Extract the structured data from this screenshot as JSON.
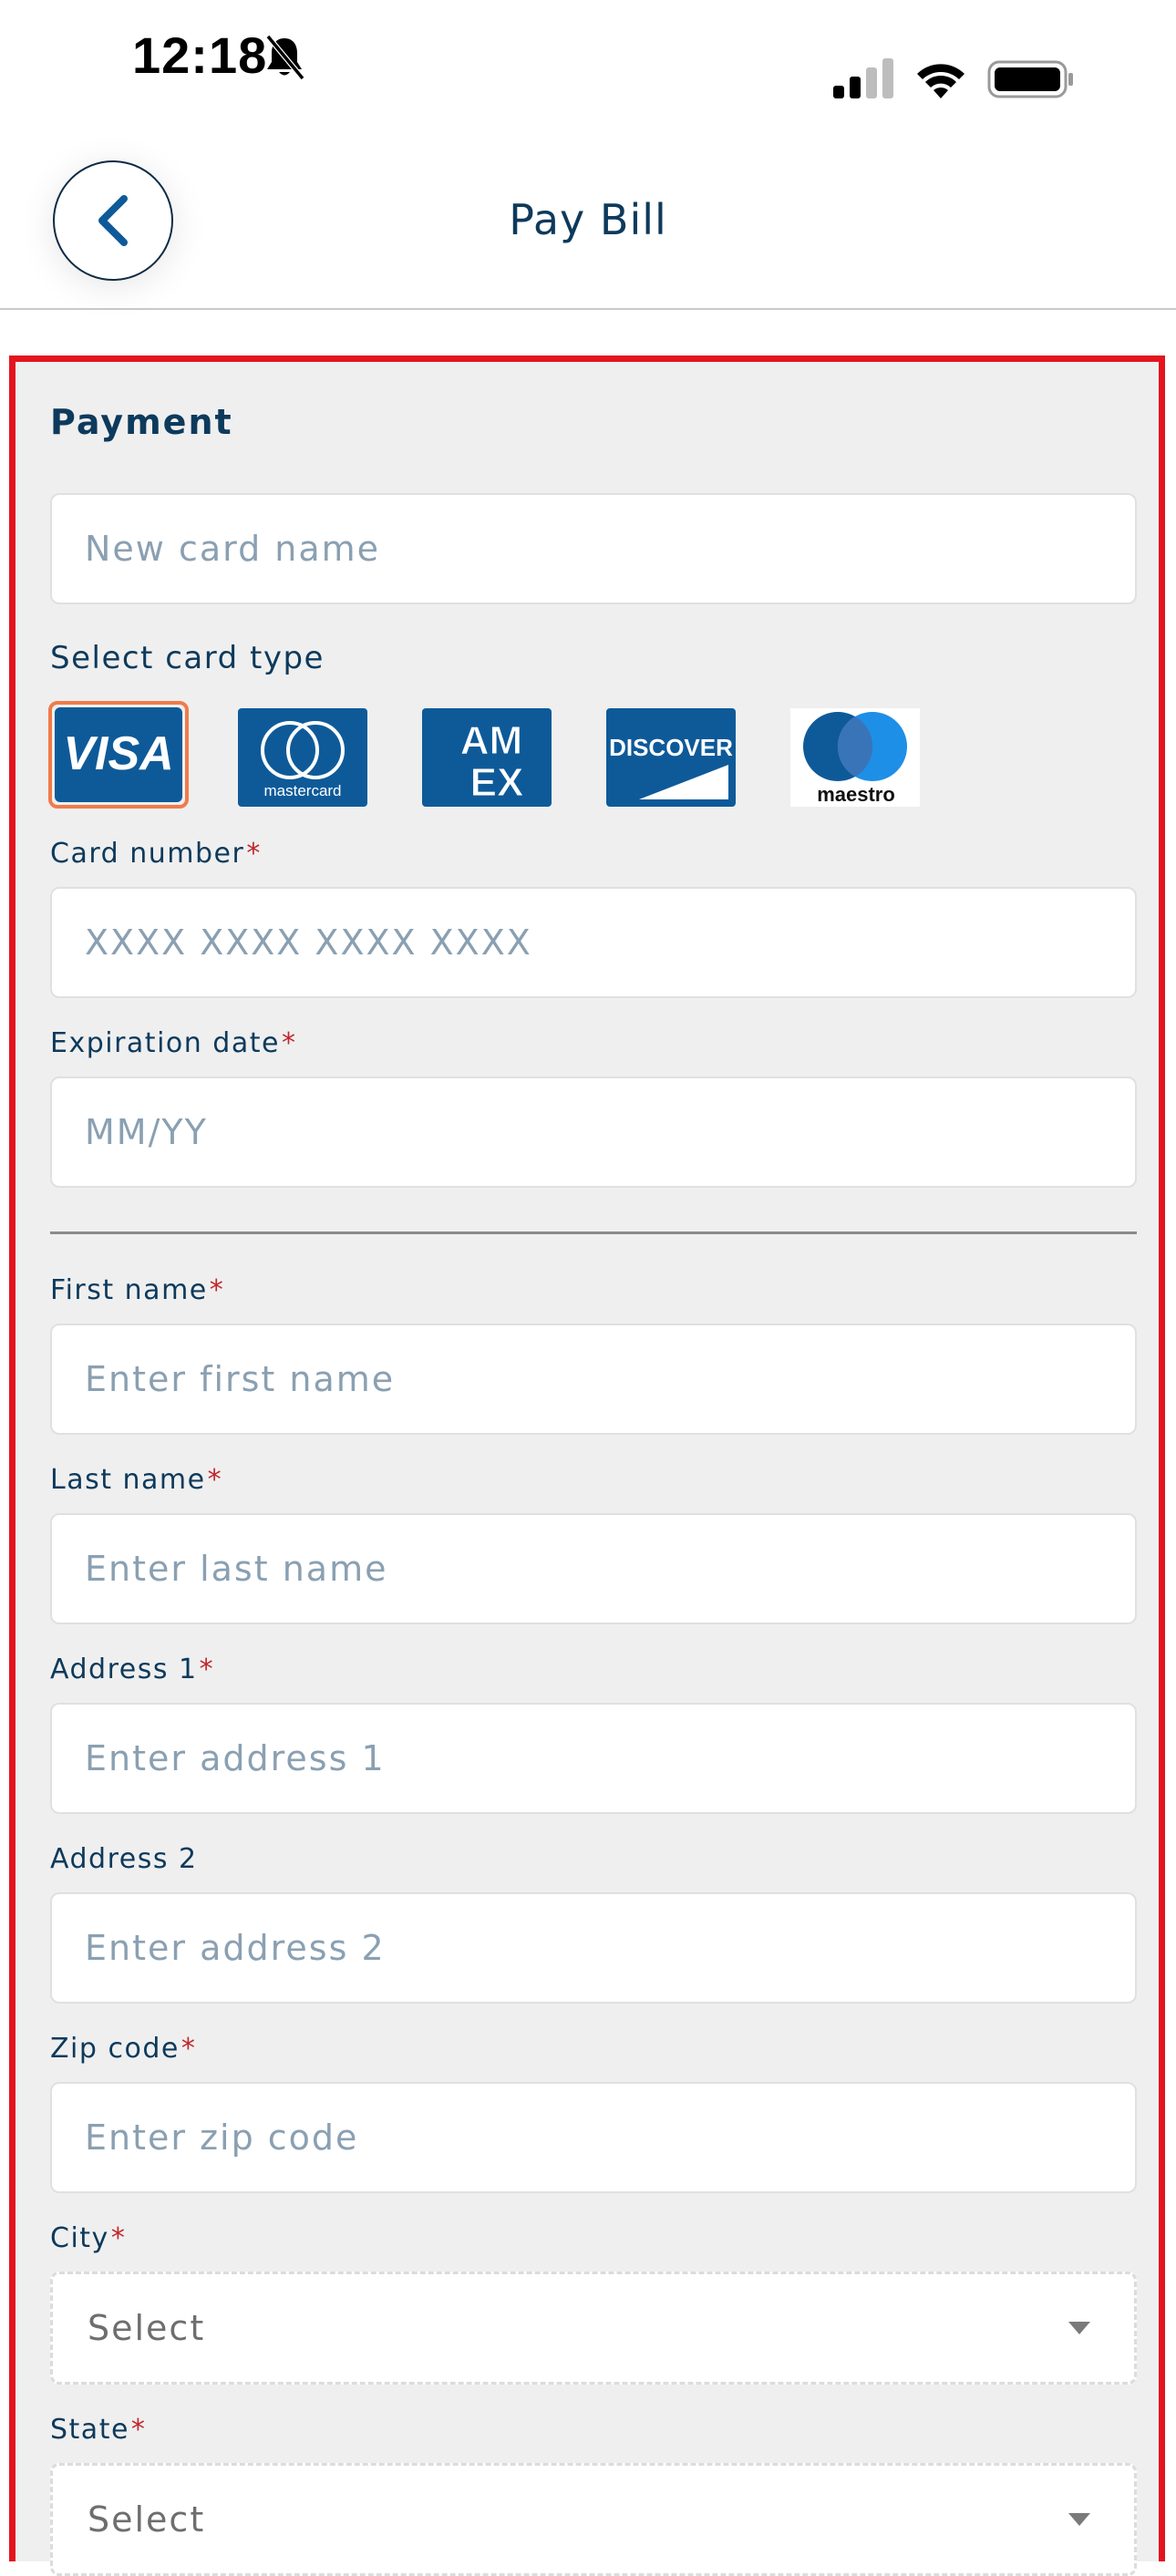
{
  "status_bar": {
    "time": "12:18"
  },
  "header": {
    "title": "Pay Bill"
  },
  "payment": {
    "section_title": "Payment",
    "card_name_placeholder": "New card name",
    "card_type_label": "Select card type",
    "card_types": [
      {
        "name": "VISA",
        "selected": true
      },
      {
        "name": "mastercard",
        "selected": false
      },
      {
        "name": "AM EX",
        "selected": false
      },
      {
        "name": "DISCOVER",
        "selected": false
      },
      {
        "name": "maestro",
        "selected": false
      }
    ],
    "card_number": {
      "label": "Card number",
      "required": "*",
      "placeholder": "XXXX XXXX XXXX XXXX"
    },
    "expiration": {
      "label": "Expiration date",
      "required": "*",
      "placeholder": "MM/YY"
    }
  },
  "billing": {
    "first_name": {
      "label": "First name",
      "required": "*",
      "placeholder": "Enter first name"
    },
    "last_name": {
      "label": "Last name",
      "required": "*",
      "placeholder": "Enter last name"
    },
    "address1": {
      "label": "Address 1",
      "required": "*",
      "placeholder": "Enter address 1"
    },
    "address2": {
      "label": "Address 2",
      "placeholder": "Enter address 2"
    },
    "zip": {
      "label": "Zip code",
      "required": "*",
      "placeholder": "Enter zip code"
    },
    "city": {
      "label": "City",
      "required": "*",
      "value": "Select"
    },
    "state": {
      "label": "State",
      "required": "*",
      "value": "Select"
    }
  },
  "colors": {
    "highlight_border": "#e3141e",
    "selected_card_border": "#f07b4a",
    "brand_blue": "#0e5a99",
    "text_primary": "#0d3a5c",
    "placeholder": "#8aa0b2"
  },
  "icons": [
    "bell-slash-icon",
    "cellular-signal-icon",
    "wifi-icon",
    "battery-icon",
    "chevron-left-icon",
    "dropdown-caret-icon"
  ]
}
